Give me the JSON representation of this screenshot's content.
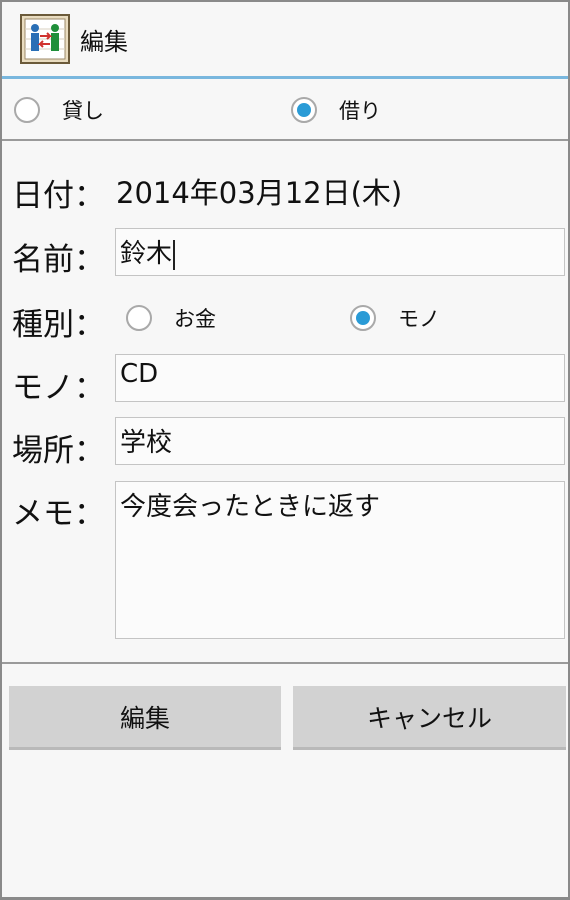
{
  "app": {
    "title": "編集"
  },
  "lend_type": {
    "options": [
      {
        "label": "貸し",
        "checked": false
      },
      {
        "label": "借り",
        "checked": true
      }
    ]
  },
  "form": {
    "date_label": "日付：",
    "date_value": "2014年03月12日(木)",
    "name_label": "名前：",
    "name_value": "鈴木",
    "kind_label": "種別：",
    "kind_options": [
      {
        "label": "お金",
        "checked": false
      },
      {
        "label": "モノ",
        "checked": true
      }
    ],
    "item_label": "モノ：",
    "item_value": "CD",
    "place_label": "場所：",
    "place_value": "学校",
    "memo_label": "メモ：",
    "memo_value": "今度会ったときに返す"
  },
  "buttons": {
    "edit_label": "編集",
    "cancel_label": "キャンセル"
  },
  "colors": {
    "accent": "#2a9bd6",
    "actionbar_line": "#79b7de",
    "button_bg": "#d2d2d2"
  }
}
